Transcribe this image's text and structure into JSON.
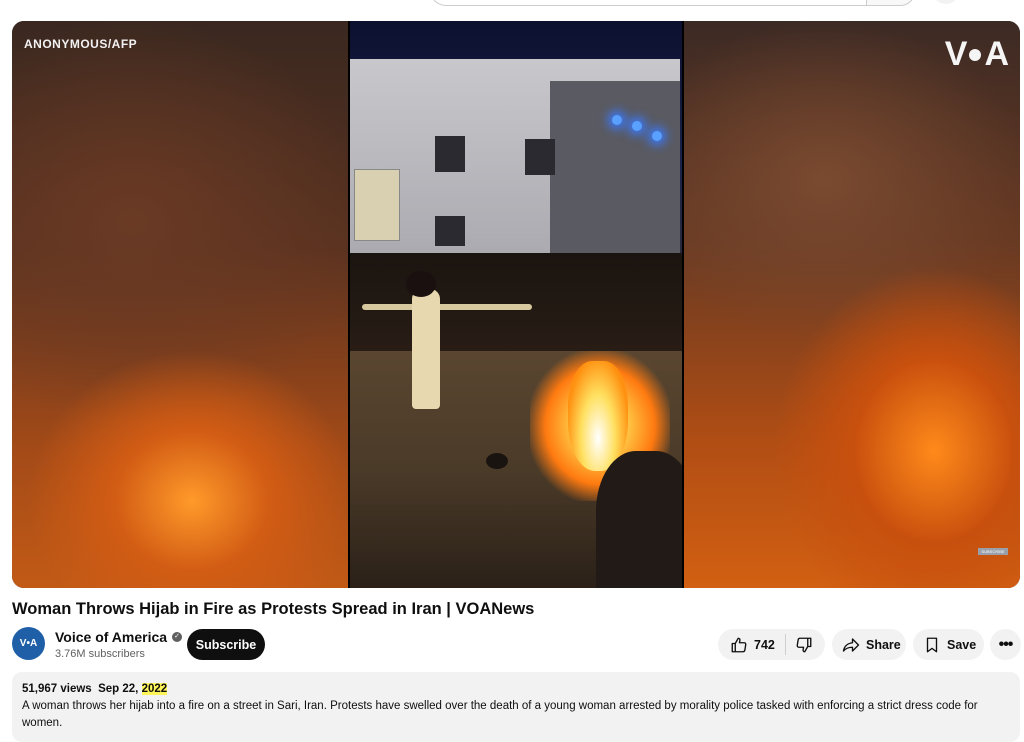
{
  "video": {
    "watermark_left": "ANONYMOUS/AFP",
    "watermark_right_letters": [
      "V",
      "A"
    ],
    "subscribe_mini": "SUBSCRIBE"
  },
  "title": "Woman Throws Hijab in Fire as Protests Spread in Iran | VOANews",
  "channel": {
    "avatar_text": "V•A",
    "name": "Voice of America",
    "subscribers": "3.76M subscribers",
    "subscribe_label": "Subscribe"
  },
  "actions": {
    "like_count": "742",
    "share_label": "Share",
    "save_label": "Save",
    "more_label": "•••"
  },
  "icons": {
    "verified": "checkmark-icon",
    "like": "thumbs-up-icon",
    "dislike": "thumbs-down-icon",
    "share": "share-arrow-icon",
    "save": "bookmark-icon",
    "more": "more-horizontal-icon"
  },
  "description": {
    "views": "51,967 views",
    "date_prefix": "Sep 22, ",
    "date_year": "2022",
    "text": "A woman throws her hijab into a fire on a street in Sari, Iran. Protests have swelled over the death of a young woman arrested by morality police tasked with enforcing a strict dress code for women."
  },
  "colors": {
    "highlight": "#fff55a",
    "subscribe_bg": "#0f0f0f",
    "pill_bg": "#f2f2f2",
    "avatar_bg": "#1f5fa8"
  }
}
